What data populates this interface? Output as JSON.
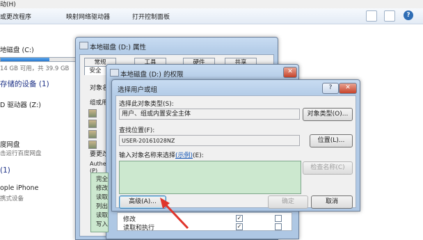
{
  "explorer": {
    "menu_fragment": "动(H)",
    "toolbar": [
      "或更改程序",
      "映射网络驱动器",
      "打开控制面板"
    ],
    "drive_c": {
      "label": "地磁盘 (C:)",
      "free_text": "14 GB 可用，共 39.9 GB",
      "used_fraction": 0.65
    },
    "removable_heading": "存储的设备 (1)",
    "drive_z": "D 驱动器 (Z:)",
    "baidu": {
      "name": "度网盘",
      "sub": "击运行百度网盘"
    },
    "other_heading": "(1)",
    "iphone": {
      "name": "ople iPhone",
      "sub": "携式设备"
    }
  },
  "properties_dialog": {
    "title": "本地磁盘 (D:) 属性",
    "tabs": [
      "常规",
      "工具",
      "硬件",
      "共享"
    ],
    "tab2": "安全",
    "label_object": "对象名",
    "label_group": "组或用",
    "label_change": "要更改",
    "label_auth": "Authe",
    "label_p": "(P)",
    "perm_rows": [
      "完全",
      "修改",
      "读取",
      "列出",
      "读取",
      "写入"
    ],
    "bottom_rows": [
      "修改",
      "读取和执行"
    ]
  },
  "permissions_dialog": {
    "title": "本地磁盘 (D:) 的权限"
  },
  "select_dialog": {
    "title": "选择用户或组",
    "label_type": "选择此对象类型(S):",
    "type_value": "用户、组或内置安全主体",
    "btn_types": "对象类型(O)...",
    "label_location": "查找位置(F):",
    "location_value": "USER-20161028NZ",
    "btn_location": "位置(L)...",
    "label_names": "输入对象名称来选择",
    "label_names_link": "(示例)",
    "label_names_tail": "(E):",
    "btn_check": "检查名称(C)",
    "btn_advanced": "高级(A)...",
    "btn_ok": "确定",
    "btn_cancel": "取消"
  },
  "window_buttons": {
    "min": "─",
    "max": "□",
    "close": "✕",
    "help": "?"
  },
  "colors": {
    "arrow": "#e0342a",
    "names_box": "#cce8cf"
  }
}
